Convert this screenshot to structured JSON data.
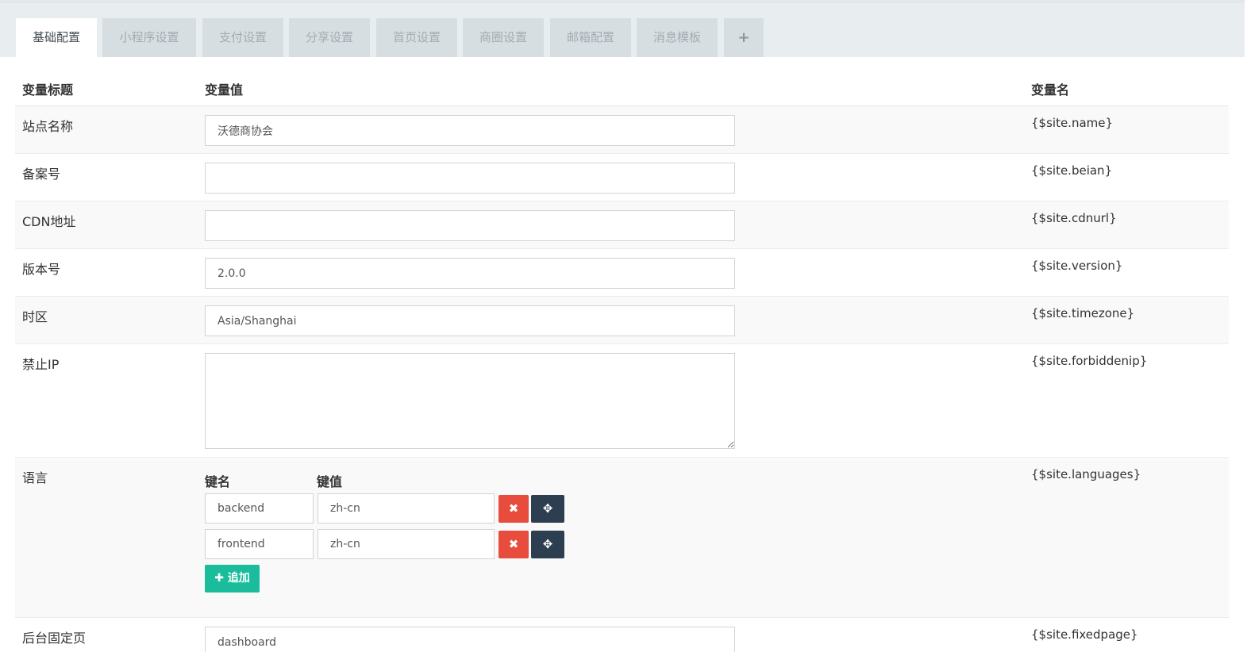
{
  "tabs": [
    {
      "label": "基础配置",
      "active": true
    },
    {
      "label": "小程序设置"
    },
    {
      "label": "支付设置"
    },
    {
      "label": "分享设置"
    },
    {
      "label": "首页设置"
    },
    {
      "label": "商圈设置"
    },
    {
      "label": "邮箱配置"
    },
    {
      "label": "消息模板"
    },
    {
      "label": "+"
    }
  ],
  "table": {
    "headers": {
      "title": "变量标题",
      "value": "变量值",
      "name": "变量名"
    },
    "rows": [
      {
        "label": "站点名称",
        "value": "沃德商协会",
        "varname": "{$site.name}"
      },
      {
        "label": "备案号",
        "value": "",
        "varname": "{$site.beian}"
      },
      {
        "label": "CDN地址",
        "value": "",
        "varname": "{$site.cdnurl}"
      },
      {
        "label": "版本号",
        "value": "2.0.0",
        "varname": "{$site.version}"
      },
      {
        "label": "时区",
        "value": "Asia/Shanghai",
        "varname": "{$site.timezone}"
      },
      {
        "label": "禁止IP",
        "value": "",
        "varname": "{$site.forbiddenip}"
      },
      {
        "label": "语言",
        "varname": "{$site.languages}"
      },
      {
        "label": "后台固定页",
        "value": "dashboard",
        "varname": "{$site.fixedpage}"
      }
    ]
  },
  "languages": {
    "key_header": "键名",
    "value_header": "键值",
    "items": [
      {
        "key": "backend",
        "value": "zh-cn"
      },
      {
        "key": "frontend",
        "value": "zh-cn"
      }
    ],
    "add_label": "✚ 追加",
    "delete_glyph": "✖",
    "move_glyph": "✥"
  }
}
